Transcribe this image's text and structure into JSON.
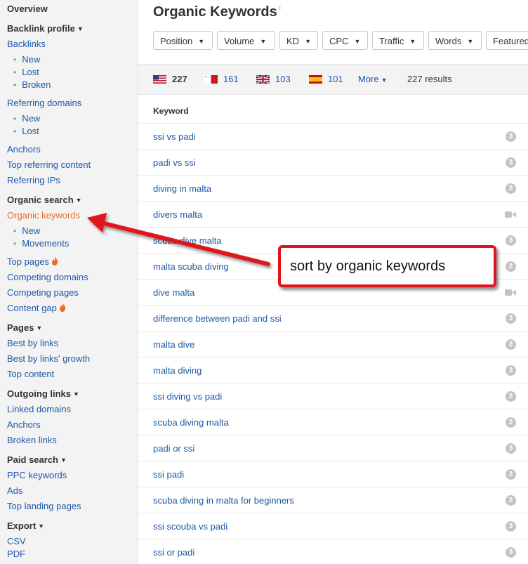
{
  "sidebar": {
    "overview": "Overview",
    "backlink_profile": {
      "heading": "Backlink profile",
      "backlinks": "Backlinks",
      "new": "New",
      "lost": "Lost",
      "broken": "Broken",
      "referring_domains": "Referring domains",
      "rd_new": "New",
      "rd_lost": "Lost",
      "anchors": "Anchors",
      "top_referring_content": "Top referring content",
      "referring_ips": "Referring IPs"
    },
    "organic_search": {
      "heading": "Organic search",
      "organic_keywords": "Organic keywords",
      "new": "New",
      "movements": "Movements",
      "top_pages": "Top pages",
      "competing_domains": "Competing domains",
      "competing_pages": "Competing pages",
      "content_gap": "Content gap"
    },
    "pages": {
      "heading": "Pages",
      "best_by_links": "Best by links",
      "best_by_links_growth": "Best by links' growth",
      "top_content": "Top content"
    },
    "outgoing_links": {
      "heading": "Outgoing links",
      "linked_domains": "Linked domains",
      "anchors": "Anchors",
      "broken_links": "Broken links"
    },
    "paid_search": {
      "heading": "Paid search",
      "ppc_keywords": "PPC keywords",
      "ads": "Ads",
      "top_landing_pages": "Top landing pages"
    },
    "export": {
      "heading": "Export",
      "csv": "CSV",
      "pdf": "PDF"
    }
  },
  "main": {
    "title": "Organic Keywords",
    "info_mark": "i",
    "filters": [
      "Position",
      "Volume",
      "KD",
      "CPC",
      "Traffic",
      "Words",
      "Featured"
    ],
    "countries": [
      {
        "code": "us",
        "count": "227"
      },
      {
        "code": "mt",
        "count": "161"
      },
      {
        "code": "gb",
        "count": "103"
      },
      {
        "code": "es",
        "count": "101"
      }
    ],
    "more_label": "More",
    "results_label": "227 results",
    "column_header": "Keyword",
    "rows": [
      {
        "keyword": "ssi vs padi",
        "badge": "3"
      },
      {
        "keyword": "padi vs ssi",
        "badge": "3"
      },
      {
        "keyword": "diving in malta",
        "badge": "2"
      },
      {
        "keyword": "divers malta",
        "badge": "video-icon"
      },
      {
        "keyword": "scuba dive malta",
        "badge": "3"
      },
      {
        "keyword": "malta scuba diving",
        "badge": "2"
      },
      {
        "keyword": "dive malta",
        "badge": "video-icon"
      },
      {
        "keyword": "difference between padi and ssi",
        "badge": "3"
      },
      {
        "keyword": "malta dive",
        "badge": "2"
      },
      {
        "keyword": "malta diving",
        "badge": "3"
      },
      {
        "keyword": "ssi diving vs padi",
        "badge": "2"
      },
      {
        "keyword": "scuba diving malta",
        "badge": "2"
      },
      {
        "keyword": "padi or ssi",
        "badge": "3"
      },
      {
        "keyword": "ssi padi",
        "badge": "2"
      },
      {
        "keyword": "scuba diving in malta for beginners",
        "badge": "2"
      },
      {
        "keyword": "ssi scouba vs padi",
        "badge": "3"
      },
      {
        "keyword": "ssi or padi",
        "badge": "3"
      }
    ]
  },
  "annotation": {
    "text": "sort by organic keywords",
    "color": "#e0141b"
  },
  "colors": {
    "link": "#1e58a8",
    "active": "#f26a21",
    "sidebar_bg": "#f3f3f3"
  }
}
